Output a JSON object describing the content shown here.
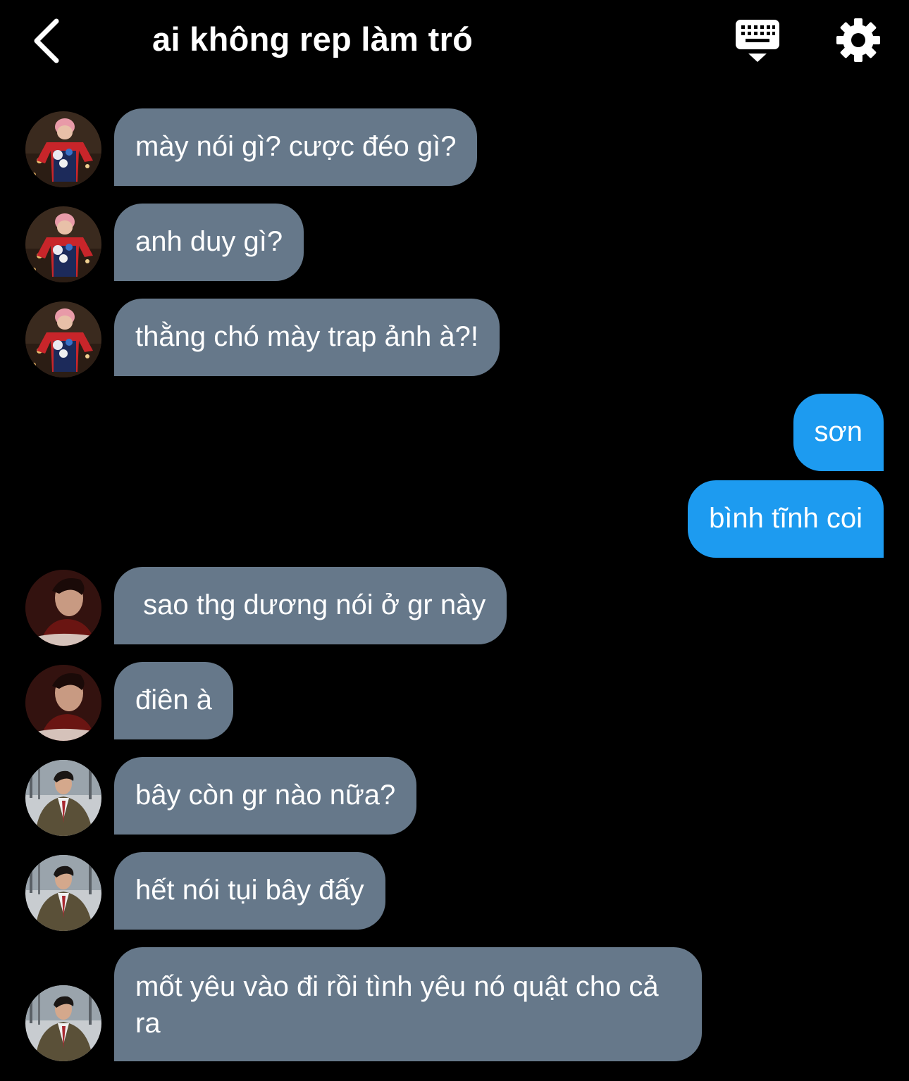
{
  "header": {
    "title": "ai không rep làm tró",
    "back_icon": "chevron-left-icon",
    "keyboard_icon": "keyboard-icon",
    "settings_icon": "gear-icon"
  },
  "colors": {
    "background": "#000000",
    "incoming_bubble": "#66788a",
    "outgoing_bubble": "#1d9bf0",
    "text": "#ffffff"
  },
  "messages": [
    {
      "from": "other",
      "sender_avatar": "avatar-red-shirt",
      "text": "mày nói gì? cược đéo gì?"
    },
    {
      "from": "other",
      "sender_avatar": "avatar-red-shirt",
      "text": "anh duy gì?"
    },
    {
      "from": "other",
      "sender_avatar": "avatar-red-shirt",
      "text": "thằng chó mày trap ảnh à?!"
    },
    {
      "from": "me",
      "text": "sơn"
    },
    {
      "from": "me",
      "text": "bình tĩnh coi"
    },
    {
      "from": "other",
      "sender_avatar": "avatar-dark-portrait",
      "text": " sao thg dương nói ở gr này"
    },
    {
      "from": "other",
      "sender_avatar": "avatar-dark-portrait",
      "text": "điên à"
    },
    {
      "from": "other",
      "sender_avatar": "avatar-trench-coat",
      "text": "bây còn gr nào nữa?"
    },
    {
      "from": "other",
      "sender_avatar": "avatar-trench-coat",
      "text": "hết nói tụi bây đấy"
    },
    {
      "from": "other",
      "sender_avatar": "avatar-trench-coat",
      "text": "mốt yêu vào đi rồi tình yêu nó quật cho cả ra"
    }
  ]
}
